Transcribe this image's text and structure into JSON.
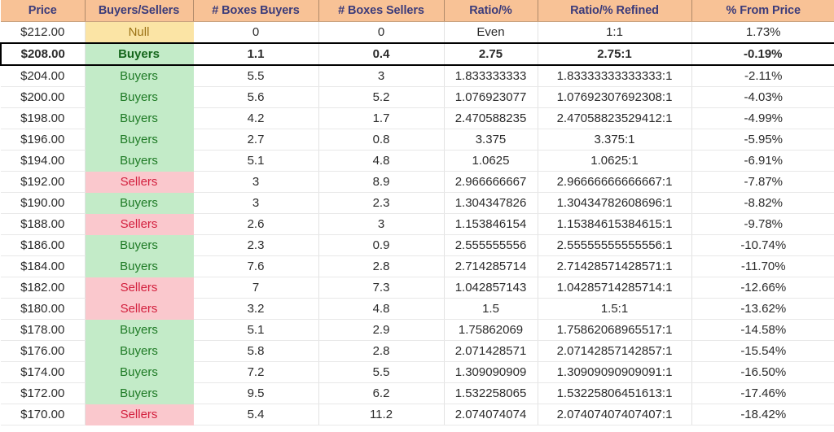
{
  "table": {
    "name": "buyers-sellers-ratio-sheet",
    "colors": {
      "header_bg": "#F8C296",
      "header_text": "#3B3B7A",
      "buyers_bg": "#C3EBC8",
      "buyers_text": "#1E7A25",
      "sellers_bg": "#FAC8CD",
      "sellers_text": "#D3203E",
      "null_bg": "#FBE4A5",
      "null_text": "#9C7316",
      "selected_border": "#000000",
      "grid_line": "#E2E2E2"
    },
    "columns": [
      "Price",
      "Buyers/Sellers",
      "# Boxes Buyers",
      "# Boxes Sellers",
      "Ratio/%",
      "Ratio/% Refined",
      "% From Price"
    ],
    "rows": [
      {
        "price": "$212.00",
        "side": "Null",
        "side_kind": "null",
        "boxes_buyers": "0",
        "boxes_sellers": "0",
        "ratio": "Even",
        "ratio_refined": "1:1",
        "pct_from_price": "1.73%",
        "selected": false
      },
      {
        "price": "$208.00",
        "side": "Buyers",
        "side_kind": "buyers",
        "boxes_buyers": "1.1",
        "boxes_sellers": "0.4",
        "ratio": "2.75",
        "ratio_refined": "2.75:1",
        "pct_from_price": "-0.19%",
        "selected": true
      },
      {
        "price": "$204.00",
        "side": "Buyers",
        "side_kind": "buyers",
        "boxes_buyers": "5.5",
        "boxes_sellers": "3",
        "ratio": "1.833333333",
        "ratio_refined": "1.83333333333333:1",
        "pct_from_price": "-2.11%",
        "selected": false
      },
      {
        "price": "$200.00",
        "side": "Buyers",
        "side_kind": "buyers",
        "boxes_buyers": "5.6",
        "boxes_sellers": "5.2",
        "ratio": "1.076923077",
        "ratio_refined": "1.07692307692308:1",
        "pct_from_price": "-4.03%",
        "selected": false
      },
      {
        "price": "$198.00",
        "side": "Buyers",
        "side_kind": "buyers",
        "boxes_buyers": "4.2",
        "boxes_sellers": "1.7",
        "ratio": "2.470588235",
        "ratio_refined": "2.47058823529412:1",
        "pct_from_price": "-4.99%",
        "selected": false
      },
      {
        "price": "$196.00",
        "side": "Buyers",
        "side_kind": "buyers",
        "boxes_buyers": "2.7",
        "boxes_sellers": "0.8",
        "ratio": "3.375",
        "ratio_refined": "3.375:1",
        "pct_from_price": "-5.95%",
        "selected": false
      },
      {
        "price": "$194.00",
        "side": "Buyers",
        "side_kind": "buyers",
        "boxes_buyers": "5.1",
        "boxes_sellers": "4.8",
        "ratio": "1.0625",
        "ratio_refined": "1.0625:1",
        "pct_from_price": "-6.91%",
        "selected": false
      },
      {
        "price": "$192.00",
        "side": "Sellers",
        "side_kind": "sellers",
        "boxes_buyers": "3",
        "boxes_sellers": "8.9",
        "ratio": "2.966666667",
        "ratio_refined": "2.96666666666667:1",
        "pct_from_price": "-7.87%",
        "selected": false
      },
      {
        "price": "$190.00",
        "side": "Buyers",
        "side_kind": "buyers",
        "boxes_buyers": "3",
        "boxes_sellers": "2.3",
        "ratio": "1.304347826",
        "ratio_refined": "1.30434782608696:1",
        "pct_from_price": "-8.82%",
        "selected": false
      },
      {
        "price": "$188.00",
        "side": "Sellers",
        "side_kind": "sellers",
        "boxes_buyers": "2.6",
        "boxes_sellers": "3",
        "ratio": "1.153846154",
        "ratio_refined": "1.15384615384615:1",
        "pct_from_price": "-9.78%",
        "selected": false
      },
      {
        "price": "$186.00",
        "side": "Buyers",
        "side_kind": "buyers",
        "boxes_buyers": "2.3",
        "boxes_sellers": "0.9",
        "ratio": "2.555555556",
        "ratio_refined": "2.55555555555556:1",
        "pct_from_price": "-10.74%",
        "selected": false
      },
      {
        "price": "$184.00",
        "side": "Buyers",
        "side_kind": "buyers",
        "boxes_buyers": "7.6",
        "boxes_sellers": "2.8",
        "ratio": "2.714285714",
        "ratio_refined": "2.71428571428571:1",
        "pct_from_price": "-11.70%",
        "selected": false
      },
      {
        "price": "$182.00",
        "side": "Sellers",
        "side_kind": "sellers",
        "boxes_buyers": "7",
        "boxes_sellers": "7.3",
        "ratio": "1.042857143",
        "ratio_refined": "1.04285714285714:1",
        "pct_from_price": "-12.66%",
        "selected": false
      },
      {
        "price": "$180.00",
        "side": "Sellers",
        "side_kind": "sellers",
        "boxes_buyers": "3.2",
        "boxes_sellers": "4.8",
        "ratio": "1.5",
        "ratio_refined": "1.5:1",
        "pct_from_price": "-13.62%",
        "selected": false
      },
      {
        "price": "$178.00",
        "side": "Buyers",
        "side_kind": "buyers",
        "boxes_buyers": "5.1",
        "boxes_sellers": "2.9",
        "ratio": "1.75862069",
        "ratio_refined": "1.75862068965517:1",
        "pct_from_price": "-14.58%",
        "selected": false
      },
      {
        "price": "$176.00",
        "side": "Buyers",
        "side_kind": "buyers",
        "boxes_buyers": "5.8",
        "boxes_sellers": "2.8",
        "ratio": "2.071428571",
        "ratio_refined": "2.07142857142857:1",
        "pct_from_price": "-15.54%",
        "selected": false
      },
      {
        "price": "$174.00",
        "side": "Buyers",
        "side_kind": "buyers",
        "boxes_buyers": "7.2",
        "boxes_sellers": "5.5",
        "ratio": "1.309090909",
        "ratio_refined": "1.30909090909091:1",
        "pct_from_price": "-16.50%",
        "selected": false
      },
      {
        "price": "$172.00",
        "side": "Buyers",
        "side_kind": "buyers",
        "boxes_buyers": "9.5",
        "boxes_sellers": "6.2",
        "ratio": "1.532258065",
        "ratio_refined": "1.53225806451613:1",
        "pct_from_price": "-17.46%",
        "selected": false
      },
      {
        "price": "$170.00",
        "side": "Sellers",
        "side_kind": "sellers",
        "boxes_buyers": "5.4",
        "boxes_sellers": "11.2",
        "ratio": "2.074074074",
        "ratio_refined": "2.07407407407407:1",
        "pct_from_price": "-18.42%",
        "selected": false
      }
    ]
  }
}
